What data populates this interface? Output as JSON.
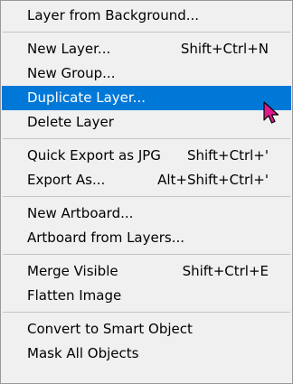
{
  "colors": {
    "menu_background": "#f0f0f0",
    "highlight_background": "#0078d7",
    "highlight_text": "#ffffff",
    "text": "#000000",
    "separator": "#c4c4c4",
    "cursor_fill": "#e0188b"
  },
  "menu": {
    "groups": [
      [
        {
          "label": "Layer from Background...",
          "shortcut": ""
        }
      ],
      [
        {
          "label": "New Layer...",
          "shortcut": "Shift+Ctrl+N"
        },
        {
          "label": "New Group...",
          "shortcut": ""
        },
        {
          "label": "Duplicate Layer...",
          "shortcut": "",
          "highlighted": true
        },
        {
          "label": "Delete Layer",
          "shortcut": ""
        }
      ],
      [
        {
          "label": "Quick Export as JPG",
          "shortcut": "Shift+Ctrl+'"
        },
        {
          "label": "Export As...",
          "shortcut": "Alt+Shift+Ctrl+'"
        }
      ],
      [
        {
          "label": "New Artboard...",
          "shortcut": ""
        },
        {
          "label": "Artboard from Layers...",
          "shortcut": ""
        }
      ],
      [
        {
          "label": "Merge Visible",
          "shortcut": "Shift+Ctrl+E"
        },
        {
          "label": "Flatten Image",
          "shortcut": ""
        }
      ],
      [
        {
          "label": "Convert to Smart Object",
          "shortcut": ""
        },
        {
          "label": "Mask All Objects",
          "shortcut": ""
        }
      ]
    ]
  },
  "cursor": {
    "icon": "mouse-pointer-icon"
  }
}
